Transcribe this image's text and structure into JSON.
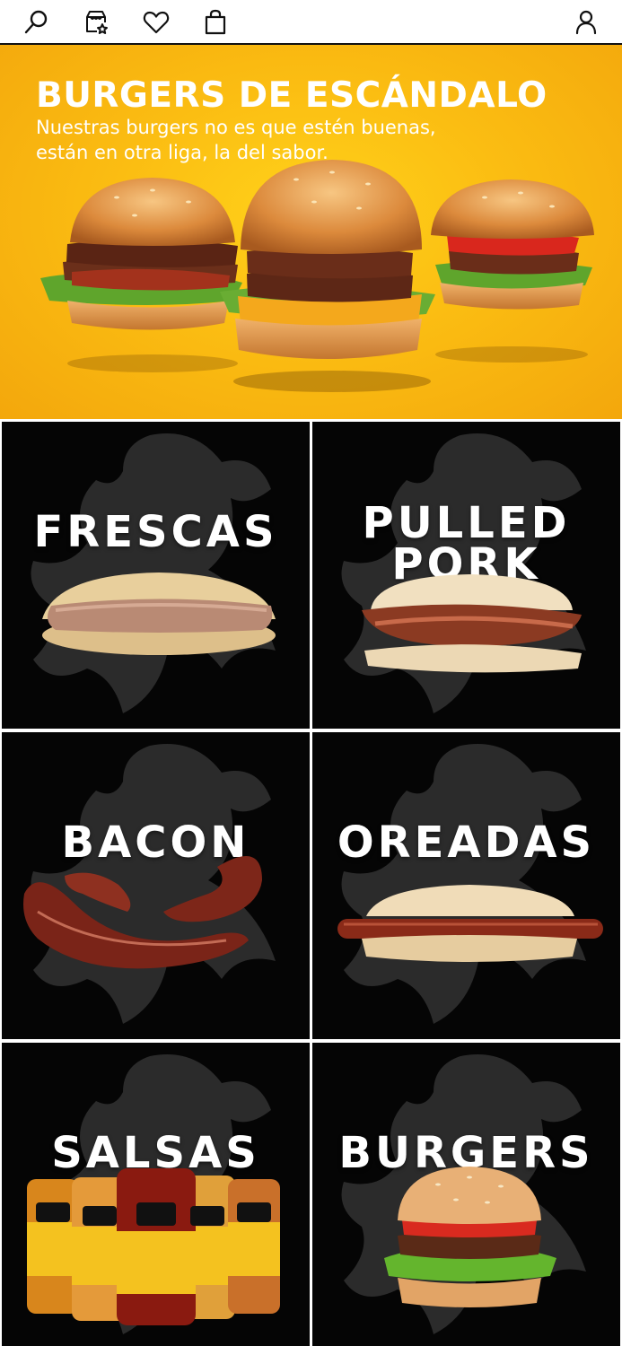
{
  "nav": {
    "icons": [
      "search-icon",
      "favorites-icon",
      "heart-icon",
      "bag-icon",
      "user-icon"
    ]
  },
  "hero": {
    "title": "BURGERS DE ESCÁNDALO",
    "subtitle_line1": "Nuestras burgers no es que estén buenas,",
    "subtitle_line2": "están en otra liga, la del sabor.",
    "background_color": "#fbbd12"
  },
  "categories": [
    {
      "label": "FRESCAS"
    },
    {
      "label_line1": "PULLED",
      "label_line2": "PORK"
    },
    {
      "label": "BACON"
    },
    {
      "label": "OREADAS"
    },
    {
      "label": "SALSAS"
    },
    {
      "label": "BURGERS"
    }
  ],
  "colors": {
    "tile_background": "#050505",
    "text": "#ffffff"
  }
}
